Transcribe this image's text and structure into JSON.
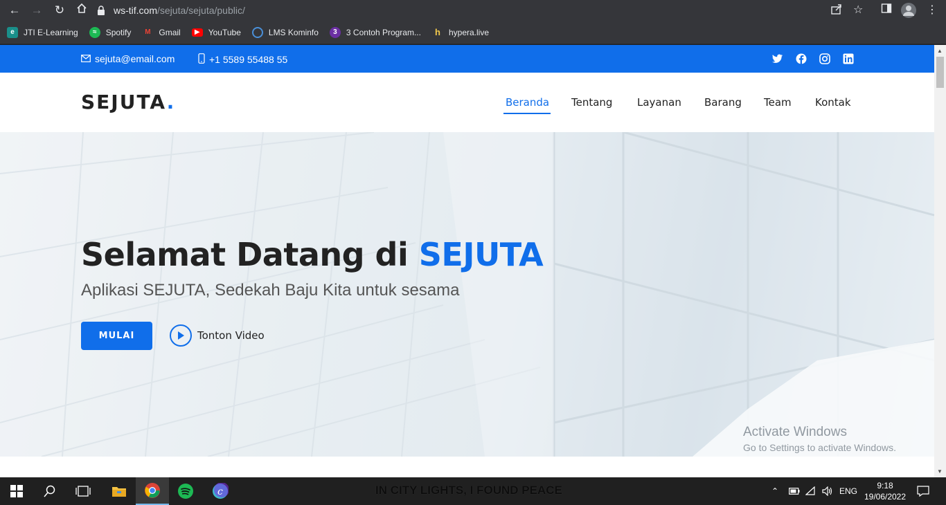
{
  "browser": {
    "url_host": "ws-tif.com",
    "url_path": "/sejuta/sejuta/public/",
    "bookmarks": [
      {
        "label": "JTI E-Learning",
        "icon": "jti-icon",
        "color": "#1a8f8a"
      },
      {
        "label": "Spotify",
        "icon": "spotify-icon",
        "color": "#1db954"
      },
      {
        "label": "Gmail",
        "icon": "gmail-icon",
        "color": "#ea4335"
      },
      {
        "label": "YouTube",
        "icon": "youtube-icon",
        "color": "#ff0000"
      },
      {
        "label": "LMS Kominfo",
        "icon": "lms-icon",
        "color": "#4a90d9"
      },
      {
        "label": "3 Contoh Program...",
        "icon": "program-icon",
        "color": "#6b2fa3"
      },
      {
        "label": "hypera.live",
        "icon": "hypera-icon",
        "color": "#f2c94c"
      }
    ]
  },
  "topbar": {
    "email": "sejuta@email.com",
    "phone": "+1 5589 55488 55",
    "color": "#106eea",
    "social": [
      "twitter-icon",
      "facebook-icon",
      "instagram-icon",
      "linkedin-icon"
    ]
  },
  "header": {
    "logo": "SEJUTA",
    "logo_dot": ".",
    "menu": [
      "Beranda",
      "Tentang",
      "Layanan",
      "Barang",
      "Team",
      "Kontak"
    ],
    "active_menu": "Beranda"
  },
  "hero": {
    "title_prefix": "Selamat Datang di",
    "title_brand": "SEJUTA",
    "subtitle": "Aplikasi SEJUTA, Sedekah Baju Kita untuk sesama",
    "cta_label": "MULAI",
    "video_label": "Tonton Video"
  },
  "watermark": {
    "line1": "Activate Windows",
    "line2": "Go to Settings to activate Windows."
  },
  "taskbar": {
    "now_playing": "IN CITY LIGHTS, I FOUND PEACE",
    "language": "ENG",
    "time": "9:18",
    "date": "19/06/2022"
  }
}
